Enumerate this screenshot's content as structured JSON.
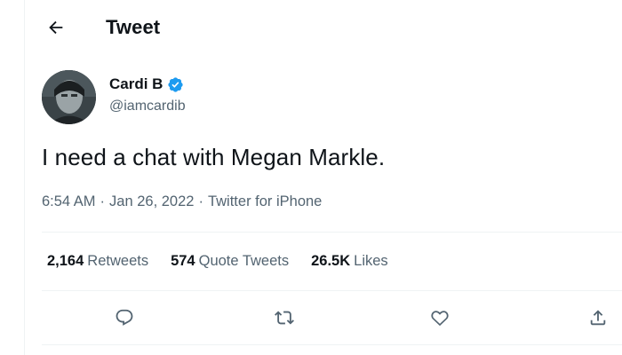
{
  "header": {
    "back_icon": "arrow-left-icon",
    "title": "Tweet"
  },
  "author": {
    "name": "Cardi B",
    "handle": "@iamcardib",
    "verified_icon": "verified-badge-icon",
    "verified_color": "#1d9bf0"
  },
  "tweet": {
    "text": "I need a chat with Megan Markle.",
    "time": "6:54 AM",
    "date": "Jan 26, 2022",
    "separator": "·",
    "source": "Twitter for iPhone"
  },
  "stats": {
    "retweets_count": "2,164",
    "retweets_label": "Retweets",
    "quotes_count": "574",
    "quotes_label": "Quote Tweets",
    "likes_count": "26.5K",
    "likes_label": "Likes"
  },
  "actions": {
    "reply_icon": "reply-icon",
    "retweet_icon": "retweet-icon",
    "like_icon": "heart-icon",
    "share_icon": "share-icon"
  },
  "colors": {
    "text_primary": "#0f1419",
    "text_secondary": "#536471",
    "border": "#eff3f4",
    "accent": "#1d9bf0"
  }
}
